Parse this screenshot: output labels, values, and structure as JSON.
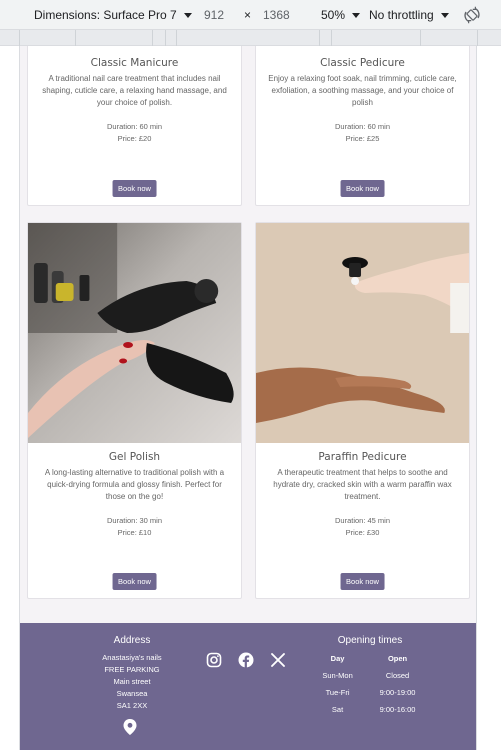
{
  "devtools": {
    "dimensions_label": "Dimensions: Surface Pro 7",
    "width": "912",
    "times": "×",
    "height": "1368",
    "zoom": "50%",
    "throttling": "No throttling"
  },
  "cards": [
    {
      "title": "Classic Manicure",
      "description": "A traditional nail care treatment that includes nail shaping, cuticle care, a relaxing hand massage, and your choice of polish.",
      "duration": "Duration: 60 min",
      "price": "Price: £20",
      "button": "Book now"
    },
    {
      "title": "Classic Pedicure",
      "description": "Enjoy a relaxing foot soak, nail trimming, cuticle care, exfoliation, a soothing massage, and your choice of polish",
      "duration": "Duration: 60 min",
      "price": "Price: £25",
      "button": "Book now"
    },
    {
      "title": "Gel Polish",
      "description": "A long-lasting alternative to traditional polish with a quick-drying formula and glossy finish. Perfect for those on the go!",
      "duration": "Duration: 30 min",
      "price": "Price: £10",
      "button": "Book now"
    },
    {
      "title": "Paraffin Pedicure",
      "description": "A therapeutic treatment that helps to soothe and hydrate dry, cracked skin with a warm paraffin wax treatment.",
      "duration": "Duration: 45 min",
      "price": "Price: £30",
      "button": "Book now"
    }
  ],
  "footer": {
    "address_title": "Address",
    "address_lines": [
      "Anastasiya's nails",
      "FREE PARKING",
      "Main street",
      "Swansea",
      "SA1 2XX"
    ],
    "social_icons": [
      "instagram-icon",
      "facebook-icon",
      "x-icon"
    ],
    "hours_title": "Opening times",
    "hours_headers": [
      "Day",
      "Open"
    ],
    "hours_rows": [
      [
        "Sun-Mon",
        "Closed"
      ],
      [
        "Tue-Fri",
        "9:00-19:00"
      ],
      [
        "Sat",
        "9:00-16:00"
      ]
    ]
  },
  "colors": {
    "accent": "#6f6790",
    "page_bg": "#f5f3f6"
  }
}
